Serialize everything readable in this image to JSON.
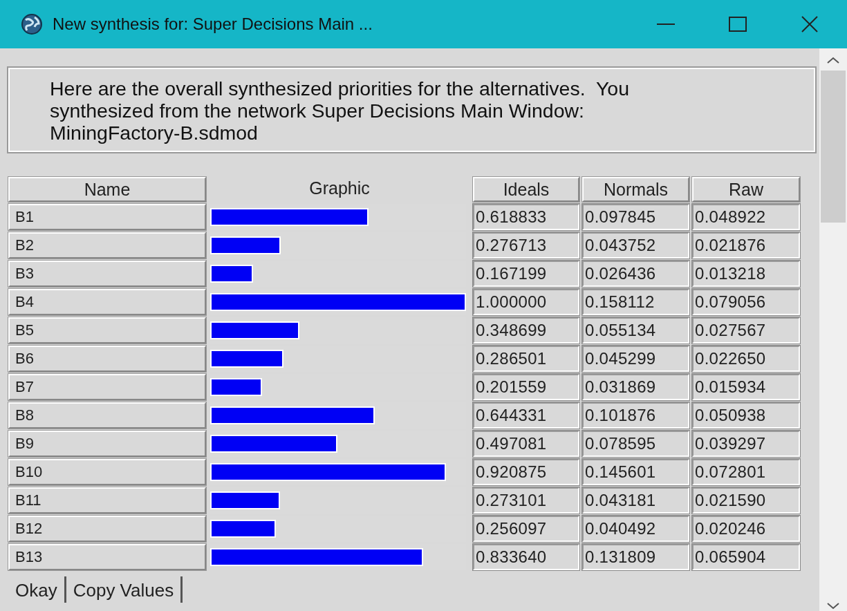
{
  "window": {
    "title": "New synthesis for: Super Decisions Main ..."
  },
  "message": "Here are the overall synthesized priorities for the alternatives.  You synthesized from the network Super Decisions Main Window: MiningFactory-B.sdmod",
  "table": {
    "columns": [
      "Name",
      "Graphic",
      "Ideals",
      "Normals",
      "Raw"
    ],
    "rows": [
      {
        "name": "B1",
        "level": 0.618833,
        "ideals": "0.618833",
        "normals": "0.097845",
        "raw": "0.048922"
      },
      {
        "name": "B2",
        "level": 0.276713,
        "ideals": "0.276713",
        "normals": "0.043752",
        "raw": "0.021876"
      },
      {
        "name": "B3",
        "level": 0.167199,
        "ideals": "0.167199",
        "normals": "0.026436",
        "raw": "0.013218"
      },
      {
        "name": "B4",
        "level": 1.0,
        "ideals": "1.000000",
        "normals": "0.158112",
        "raw": "0.079056"
      },
      {
        "name": "B5",
        "level": 0.348699,
        "ideals": "0.348699",
        "normals": "0.055134",
        "raw": "0.027567"
      },
      {
        "name": "B6",
        "level": 0.286501,
        "ideals": "0.286501",
        "normals": "0.045299",
        "raw": "0.022650"
      },
      {
        "name": "B7",
        "level": 0.201559,
        "ideals": "0.201559",
        "normals": "0.031869",
        "raw": "0.015934"
      },
      {
        "name": "B8",
        "level": 0.644331,
        "ideals": "0.644331",
        "normals": "0.101876",
        "raw": "0.050938"
      },
      {
        "name": "B9",
        "level": 0.497081,
        "ideals": "0.497081",
        "normals": "0.078595",
        "raw": "0.039297"
      },
      {
        "name": "B10",
        "level": 0.920875,
        "ideals": "0.920875",
        "normals": "0.145601",
        "raw": "0.072801"
      },
      {
        "name": "B11",
        "level": 0.273101,
        "ideals": "0.273101",
        "normals": "0.043181",
        "raw": "0.021590"
      },
      {
        "name": "B12",
        "level": 0.256097,
        "ideals": "0.256097",
        "normals": "0.040492",
        "raw": "0.020246"
      },
      {
        "name": "B13",
        "level": 0.83364,
        "ideals": "0.833640",
        "normals": "0.131809",
        "raw": "0.065904"
      }
    ]
  },
  "buttons": [
    "Okay",
    "Copy Values"
  ]
}
